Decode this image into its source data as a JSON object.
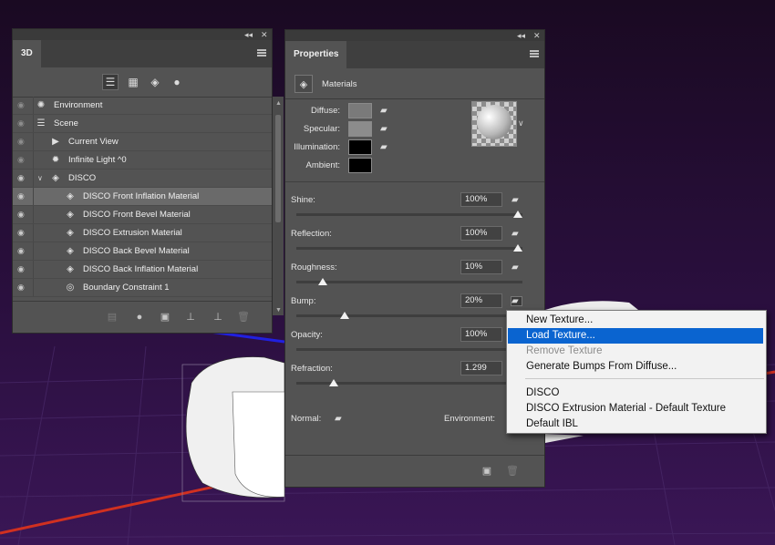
{
  "panel3d": {
    "tab": "3D",
    "collapse_glyph": "◂◂",
    "close_glyph": "✕",
    "toolbar_icons": [
      "whole-scene-filter-icon",
      "meshes-filter-icon",
      "materials-filter-icon",
      "lights-filter-icon"
    ],
    "rows": [
      {
        "label": "Environment",
        "icon": "environment-icon",
        "eye": "dim",
        "indent": 0
      },
      {
        "label": "Scene",
        "icon": "scene-icon",
        "eye": "dim",
        "indent": 0
      },
      {
        "label": "Current View",
        "icon": "camera-icon",
        "eye": "dim",
        "indent": 1
      },
      {
        "label": "Infinite Light ^0",
        "icon": "light-icon",
        "eye": "dim",
        "indent": 1
      },
      {
        "label": "DISCO",
        "icon": "mesh-icon",
        "eye": "on",
        "indent": 1,
        "expander": "∨"
      },
      {
        "label": "DISCO Front Inflation Material",
        "icon": "material-icon",
        "eye": "on",
        "indent": 2,
        "selected": true
      },
      {
        "label": "DISCO Front Bevel Material",
        "icon": "material-icon",
        "eye": "on",
        "indent": 2
      },
      {
        "label": "DISCO Extrusion Material",
        "icon": "material-icon",
        "eye": "on",
        "indent": 2
      },
      {
        "label": "DISCO Back Bevel Material",
        "icon": "material-icon",
        "eye": "on",
        "indent": 2
      },
      {
        "label": "DISCO Back Inflation Material",
        "icon": "material-icon",
        "eye": "on",
        "indent": 2
      },
      {
        "label": "Boundary Constraint 1",
        "icon": "constraint-icon",
        "eye": "on",
        "indent": 2
      }
    ],
    "bottom_icons": [
      "new-mesh-icon",
      "new-light-icon",
      "render-icon",
      "drop-to-ground-icon",
      "split-icon",
      "delete-icon"
    ]
  },
  "properties": {
    "tab": "Properties",
    "section": "Materials",
    "color_rows": [
      {
        "label": "Diffuse:",
        "color": "#7a7a7a"
      },
      {
        "label": "Specular:",
        "color": "#8c8c8c"
      },
      {
        "label": "Illumination:",
        "color": "#000000"
      },
      {
        "label": "Ambient:",
        "color": "#000000"
      }
    ],
    "sliders": [
      {
        "label": "Shine:",
        "value": "100%",
        "level": 1.0
      },
      {
        "label": "Reflection:",
        "value": "100%",
        "level": 1.0
      },
      {
        "label": "Roughness:",
        "value": "10%",
        "level": 0.1
      },
      {
        "label": "Bump:",
        "value": "20%",
        "level": 0.2
      },
      {
        "label": "Opacity:",
        "value": "100%",
        "level": 1.0
      },
      {
        "label": "Refraction:",
        "value": "1.299",
        "level": 0.15
      }
    ],
    "normal_label": "Normal:",
    "environment_label": "Environment:"
  },
  "texture_menu": {
    "items": [
      {
        "label": "New Texture...",
        "state": "normal"
      },
      {
        "label": "Load Texture...",
        "state": "highlighted"
      },
      {
        "label": "Remove Texture",
        "state": "disabled"
      },
      {
        "label": "Generate Bumps From Diffuse...",
        "state": "normal"
      }
    ],
    "textures": [
      {
        "label": "DISCO"
      },
      {
        "label": "DISCO Extrusion Material - Default Texture"
      },
      {
        "label": "Default IBL"
      }
    ]
  }
}
